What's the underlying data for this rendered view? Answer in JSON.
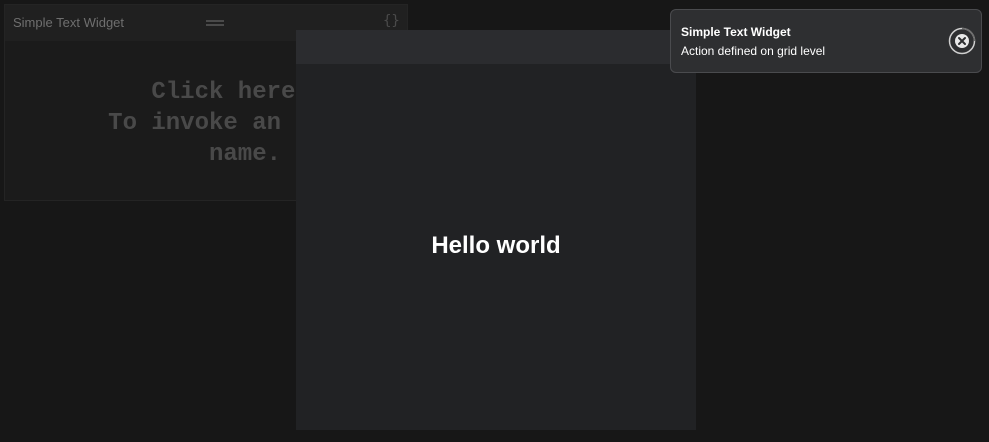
{
  "widget": {
    "title": "Simple Text Widget",
    "header_icon": "code-braces-icon",
    "drag_icon": "drag-handle-icon",
    "lines": [
      "Click here to",
      "To invoke an action",
      "name."
    ]
  },
  "modal": {
    "text": "Hello world"
  },
  "toast": {
    "title": "Simple Text Widget",
    "message": "Action defined on grid level",
    "close_icon": "close-circle-icon"
  }
}
